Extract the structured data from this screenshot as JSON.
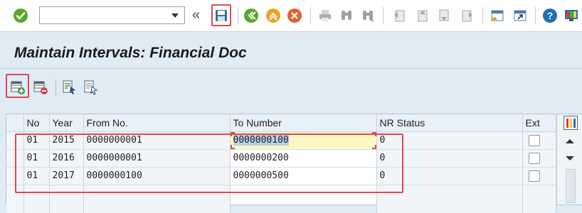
{
  "toolbar": {
    "command_field": {
      "value": "",
      "placeholder": ""
    },
    "buttons": [
      "enter-icon",
      "command-field-dropdown",
      "collapse-icon",
      "save-icon",
      "back-icon",
      "exit-icon",
      "cancel-icon",
      "print-icon",
      "find-icon",
      "find-next-icon",
      "first-page-icon",
      "previous-page-icon",
      "next-page-icon",
      "last-page-icon",
      "create-session-icon",
      "shortcut-icon",
      "help-icon",
      "customize-layout-icon"
    ]
  },
  "title": "Maintain Intervals: Financial Doc",
  "app_toolbar": {
    "buttons": [
      "insert-row-icon",
      "delete-row-icon",
      "select-all-icon",
      "deselect-all-icon"
    ]
  },
  "table": {
    "columns": [
      "No",
      "Year",
      "From No.",
      "To Number",
      "NR Status",
      "Ext"
    ],
    "rows": [
      {
        "no": "01",
        "year": "2015",
        "from": "0000000001",
        "to": "0000000100",
        "status": "0",
        "ext": false
      },
      {
        "no": "01",
        "year": "2016",
        "from": "0000000001",
        "to": "0000000200",
        "status": "0",
        "ext": false
      },
      {
        "no": "01",
        "year": "2017",
        "from": "0000000100",
        "to": "0000000500",
        "status": "0",
        "ext": false
      }
    ]
  },
  "colors": {
    "accent_red": "#e0484f",
    "title_bg": "#dfebf5",
    "focus_cell": "#fff8c4"
  }
}
